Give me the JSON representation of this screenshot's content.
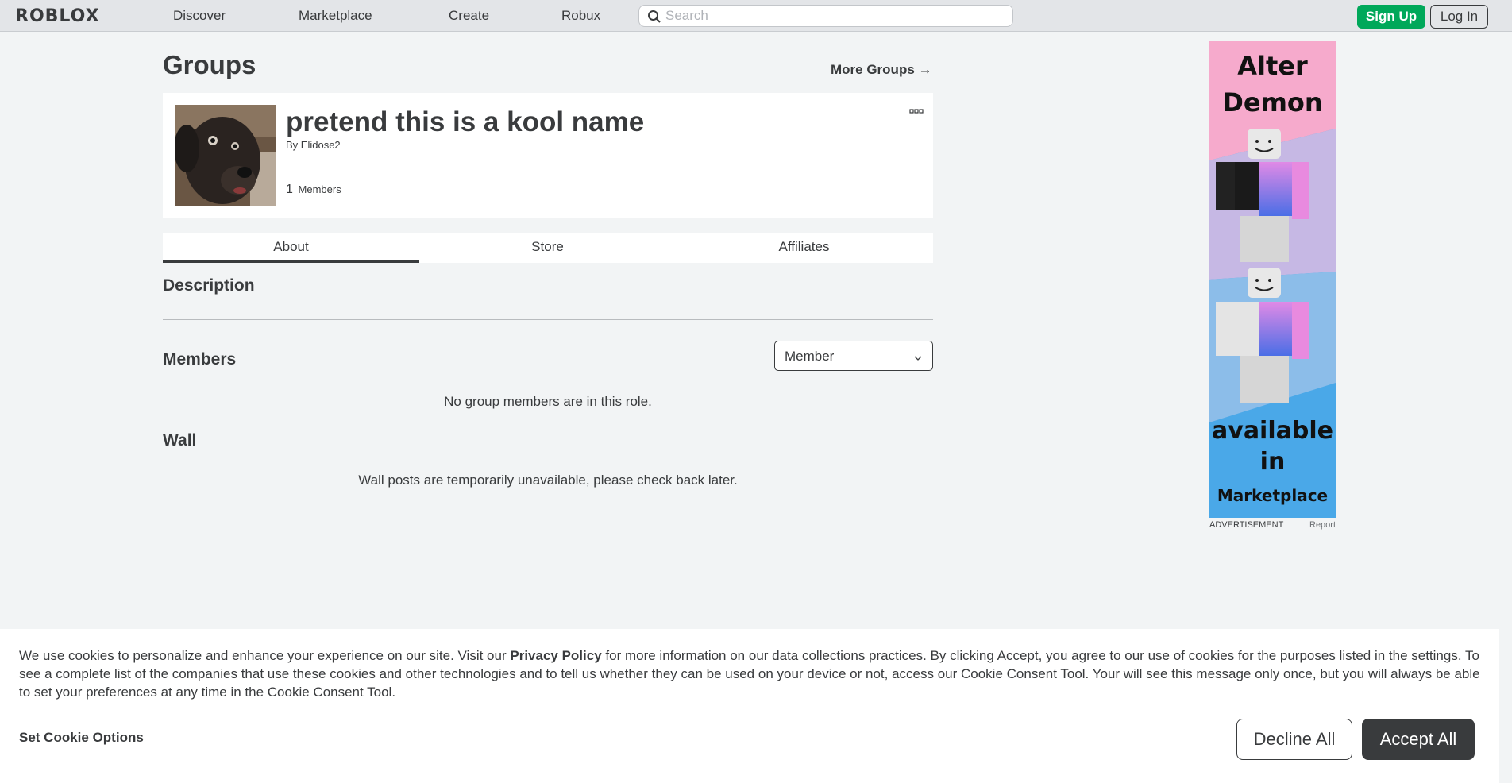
{
  "nav": {
    "logo": "ROBLOX",
    "links": [
      "Discover",
      "Marketplace",
      "Create",
      "Robux"
    ],
    "search_placeholder": "Search",
    "signup_label": "Sign Up",
    "login_label": "Log In"
  },
  "page": {
    "title": "Groups",
    "more_groups": "More Groups →"
  },
  "group": {
    "name": "pretend this is a kool name",
    "by_prefix": "By",
    "owner": "Elidose2",
    "member_count": "1",
    "members_label": "Members"
  },
  "tabs": [
    "About",
    "Store",
    "Affiliates"
  ],
  "sections": {
    "description": "Description",
    "members": "Members",
    "role_selected": "Member",
    "no_members_msg": "No group members are in this role.",
    "wall": "Wall",
    "wall_msg": "Wall posts are temporarily unavailable, please check back later."
  },
  "ad": {
    "line1": "Alter",
    "line2": "Demon",
    "line3": "available",
    "line4": "in",
    "line5": "Marketplace",
    "label": "ADVERTISEMENT",
    "report": "Report"
  },
  "cookie": {
    "text_before": "We use cookies to personalize and enhance your experience on our site. Visit our ",
    "privacy_link": "Privacy Policy",
    "text_after": " for more information on our data collections practices. By clicking Accept, you agree to our use of cookies for the purposes listed in the settings. To see a complete list of the companies that use these cookies and other technologies and to tell us whether they can be used on your device or not, access our Cookie Consent Tool. Your will see this message only once, but you will always be able to set your preferences at any time in the Cookie Consent Tool.",
    "options_label": "Set Cookie Options",
    "decline_label": "Decline All",
    "accept_label": "Accept All"
  },
  "colors": {
    "accent_green": "#00a85a",
    "text_dark": "#393b3d",
    "background": "#f2f4f5"
  }
}
